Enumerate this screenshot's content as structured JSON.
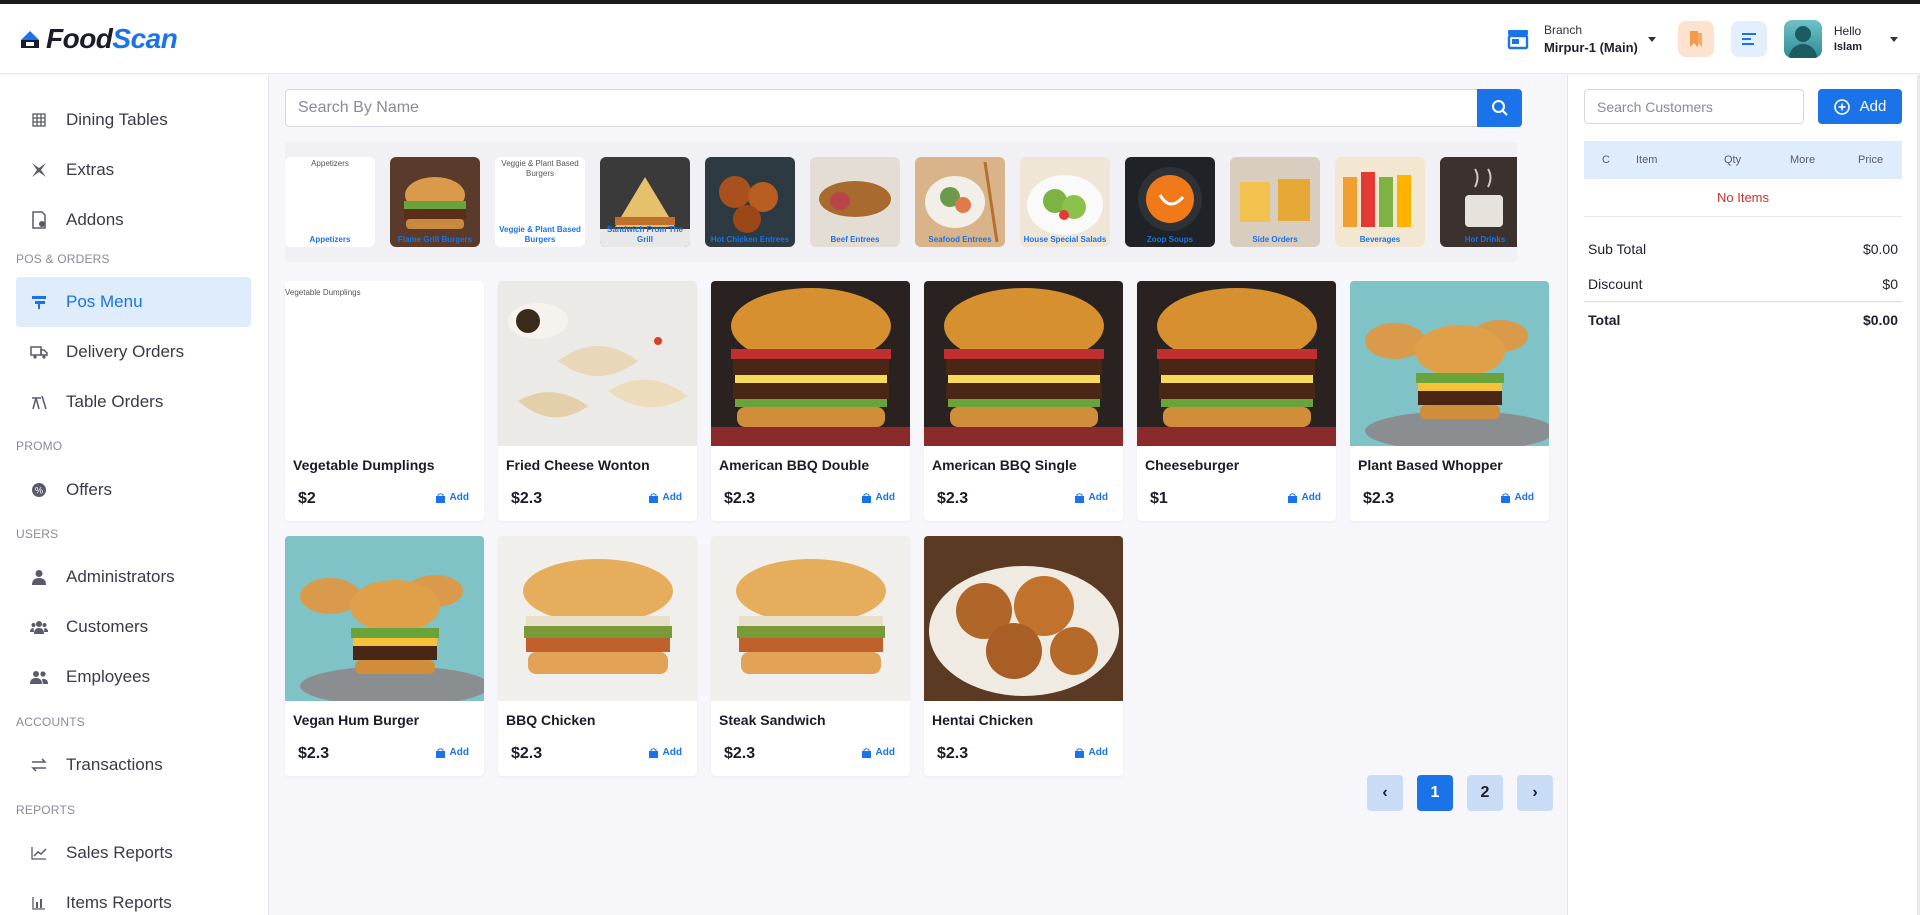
{
  "brand": {
    "food": "Food",
    "scan": "Scan"
  },
  "header": {
    "branch_label": "Branch",
    "branch_name": "Mirpur-1 (Main)",
    "greeting": "Hello",
    "user_name": "Islam"
  },
  "sidebar": {
    "items": [
      {
        "label": "Dining Tables",
        "icon": "grid-icon"
      },
      {
        "label": "Extras",
        "icon": "extras-icon"
      },
      {
        "label": "Addons",
        "icon": "addons-icon"
      },
      {
        "label": "Pos Menu",
        "icon": "pos-icon",
        "active": true
      },
      {
        "label": "Delivery Orders",
        "icon": "truck-icon"
      },
      {
        "label": "Table Orders",
        "icon": "table-orders-icon"
      },
      {
        "label": "Offers",
        "icon": "offer-icon"
      },
      {
        "label": "Administrators",
        "icon": "user-icon"
      },
      {
        "label": "Customers",
        "icon": "users-icon"
      },
      {
        "label": "Employees",
        "icon": "employees-icon"
      },
      {
        "label": "Transactions",
        "icon": "exchange-icon"
      },
      {
        "label": "Sales Reports",
        "icon": "chart-line-icon"
      },
      {
        "label": "Items Reports",
        "icon": "chart-bar-icon"
      }
    ],
    "sections": [
      "POS & ORDERS",
      "PROMO",
      "USERS",
      "ACCOUNTS",
      "REPORTS"
    ]
  },
  "search": {
    "placeholder": "Search By Name"
  },
  "categories": [
    {
      "label": "Appetizers",
      "alt": "Appetizers",
      "broken": true
    },
    {
      "label": "Flame Grill Burgers"
    },
    {
      "label": "Veggie & Plant Based Burgers",
      "alt": "Veggie & Plant Based Burgers",
      "broken": true
    },
    {
      "label": "Sandwich From The Grill"
    },
    {
      "label": "Hot Chicken Entrees"
    },
    {
      "label": "Beef Entrees"
    },
    {
      "label": "Seafood Entrees"
    },
    {
      "label": "House Special Salads"
    },
    {
      "label": "Zoop Soups"
    },
    {
      "label": "Side Orders"
    },
    {
      "label": "Beverages"
    },
    {
      "label": "Hot Drinks"
    }
  ],
  "products": [
    {
      "name": "Vegetable Dumplings",
      "price": "$2",
      "alt": "Vegetable Dumplings",
      "broken": true,
      "add": "Add"
    },
    {
      "name": "Fried Cheese Wonton",
      "price": "$2.3",
      "add": "Add"
    },
    {
      "name": "American BBQ Double",
      "price": "$2.3",
      "add": "Add"
    },
    {
      "name": "American BBQ Single",
      "price": "$2.3",
      "add": "Add"
    },
    {
      "name": "Cheeseburger",
      "price": "$1",
      "add": "Add"
    },
    {
      "name": "Plant Based Whopper",
      "price": "$2.3",
      "add": "Add"
    },
    {
      "name": "Vegan Hum Burger",
      "price": "$2.3",
      "add": "Add"
    },
    {
      "name": "BBQ Chicken",
      "price": "$2.3",
      "add": "Add"
    },
    {
      "name": "Steak Sandwich",
      "price": "$2.3",
      "add": "Add"
    },
    {
      "name": "Hentai Chicken",
      "price": "$2.3",
      "add": "Add"
    }
  ],
  "pagination": {
    "prev": "‹",
    "pages": [
      "1",
      "2"
    ],
    "current": "1",
    "next": "›"
  },
  "cart": {
    "search_placeholder": "Search Customers",
    "add_label": "Add",
    "columns": [
      "C",
      "Item",
      "Qty",
      "More",
      "Price"
    ],
    "empty": "No Items",
    "subtotal_label": "Sub Total",
    "subtotal": "$0.00",
    "discount_label": "Discount",
    "discount": "$0",
    "total_label": "Total",
    "total": "$0.00"
  },
  "colors": {
    "accent": "#1a73e8",
    "active_bg": "#deecfb",
    "danger": "#d32f2f"
  }
}
